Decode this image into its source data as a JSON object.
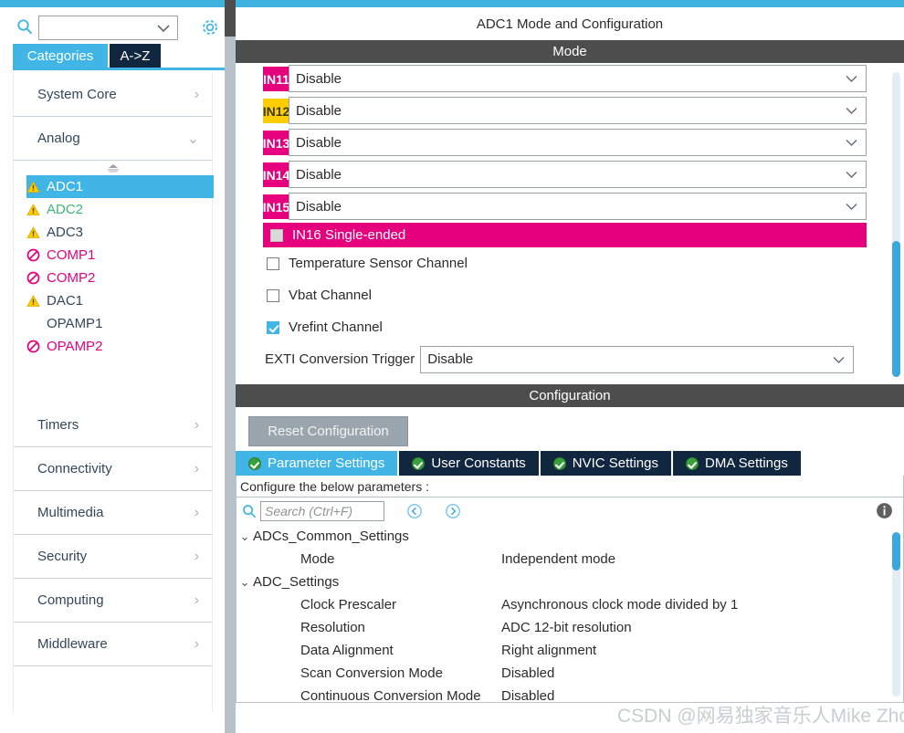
{
  "colors": {
    "accent_blue": "#41b6e6",
    "dark_navy": "#11273f",
    "bar_dark": "#4d4d4d",
    "pink": "#e6007e",
    "gold": "#ffcd00",
    "green_check": "#3a9e3a",
    "splitter": "#b7c1ca"
  },
  "sidebar": {
    "search": {
      "value": "",
      "placeholder": ""
    },
    "search_icon": "search-icon",
    "gear_icon": "gear-icon",
    "tabs": [
      {
        "label": "Categories",
        "active": true
      },
      {
        "label": "A->Z",
        "active": false
      }
    ],
    "categories": [
      {
        "label": "System Core",
        "expanded": false,
        "chevron": "›"
      },
      {
        "label": "Analog",
        "expanded": true,
        "chevron": "⌄"
      },
      {
        "label": "Timers",
        "expanded": false,
        "chevron": "›"
      },
      {
        "label": "Connectivity",
        "expanded": false,
        "chevron": "›"
      },
      {
        "label": "Multimedia",
        "expanded": false,
        "chevron": "›"
      },
      {
        "label": "Security",
        "expanded": false,
        "chevron": "›"
      },
      {
        "label": "Computing",
        "expanded": false,
        "chevron": "›"
      },
      {
        "label": "Middleware",
        "expanded": false,
        "chevron": "›"
      }
    ],
    "peripherals": [
      {
        "label": "ADC1",
        "status": "warning",
        "selected": true,
        "text_color": "#ffffff"
      },
      {
        "label": "ADC2",
        "status": "warning",
        "selected": false,
        "text_color": "#3cb878"
      },
      {
        "label": "ADC3",
        "status": "warning",
        "selected": false,
        "text_color": "#33475b"
      },
      {
        "label": "COMP1",
        "status": "blocked",
        "selected": false,
        "text_color": "#e6007e"
      },
      {
        "label": "COMP2",
        "status": "blocked",
        "selected": false,
        "text_color": "#e6007e"
      },
      {
        "label": "DAC1",
        "status": "warning",
        "selected": false,
        "text_color": "#33475b"
      },
      {
        "label": "OPAMP1",
        "status": "none",
        "selected": false,
        "text_color": "#33475b"
      },
      {
        "label": "OPAMP2",
        "status": "blocked",
        "selected": false,
        "text_color": "#e6007e"
      }
    ]
  },
  "main": {
    "title": "ADC1 Mode and Configuration",
    "mode_bar": "Mode",
    "config_bar": "Configuration",
    "channels": [
      {
        "name": "IN11",
        "badge_color": "pink",
        "value": "Disable"
      },
      {
        "name": "IN12",
        "badge_color": "gold",
        "value": "Disable"
      },
      {
        "name": "IN13",
        "badge_color": "pink",
        "value": "Disable"
      },
      {
        "name": "IN14",
        "badge_color": "pink",
        "value": "Disable"
      },
      {
        "name": "IN15",
        "badge_color": "pink",
        "value": "Disable"
      }
    ],
    "in16": {
      "label": "IN16 Single-ended",
      "checked": false,
      "highlighted": true
    },
    "checkboxes": [
      {
        "label": "Temperature Sensor Channel",
        "checked": false
      },
      {
        "label": "Vbat Channel",
        "checked": false
      },
      {
        "label": "Vrefint Channel",
        "checked": true
      }
    ],
    "exti": {
      "label": "EXTI Conversion Trigger",
      "value": "Disable"
    }
  },
  "configuration": {
    "reset_button": "Reset Configuration",
    "tabs": [
      {
        "label": "Parameter Settings",
        "active": true
      },
      {
        "label": "User Constants",
        "active": false
      },
      {
        "label": "NVIC Settings",
        "active": false
      },
      {
        "label": "DMA Settings",
        "active": false
      }
    ],
    "note": "Configure the below parameters :",
    "search": {
      "value": "",
      "placeholder": "Search (Ctrl+F)"
    },
    "nav_prev_icon": "prev-circle-icon",
    "nav_next_icon": "next-circle-icon",
    "info_icon": "info-icon",
    "tree": [
      {
        "type": "group",
        "label": "ADCs_Common_Settings",
        "expanded": true
      },
      {
        "type": "param",
        "key": "Mode",
        "value": "Independent mode"
      },
      {
        "type": "group",
        "label": "ADC_Settings",
        "expanded": true
      },
      {
        "type": "param",
        "key": "Clock Prescaler",
        "value": "Asynchronous clock mode divided by 1"
      },
      {
        "type": "param",
        "key": "Resolution",
        "value": "ADC 12-bit resolution"
      },
      {
        "type": "param",
        "key": "Data Alignment",
        "value": "Right alignment"
      },
      {
        "type": "param",
        "key": "Scan Conversion Mode",
        "value": "Disabled"
      },
      {
        "type": "param",
        "key": "Continuous Conversion Mode",
        "value": "Disabled"
      }
    ]
  },
  "watermark": "CSDN @网易独家音乐人Mike Zhou"
}
